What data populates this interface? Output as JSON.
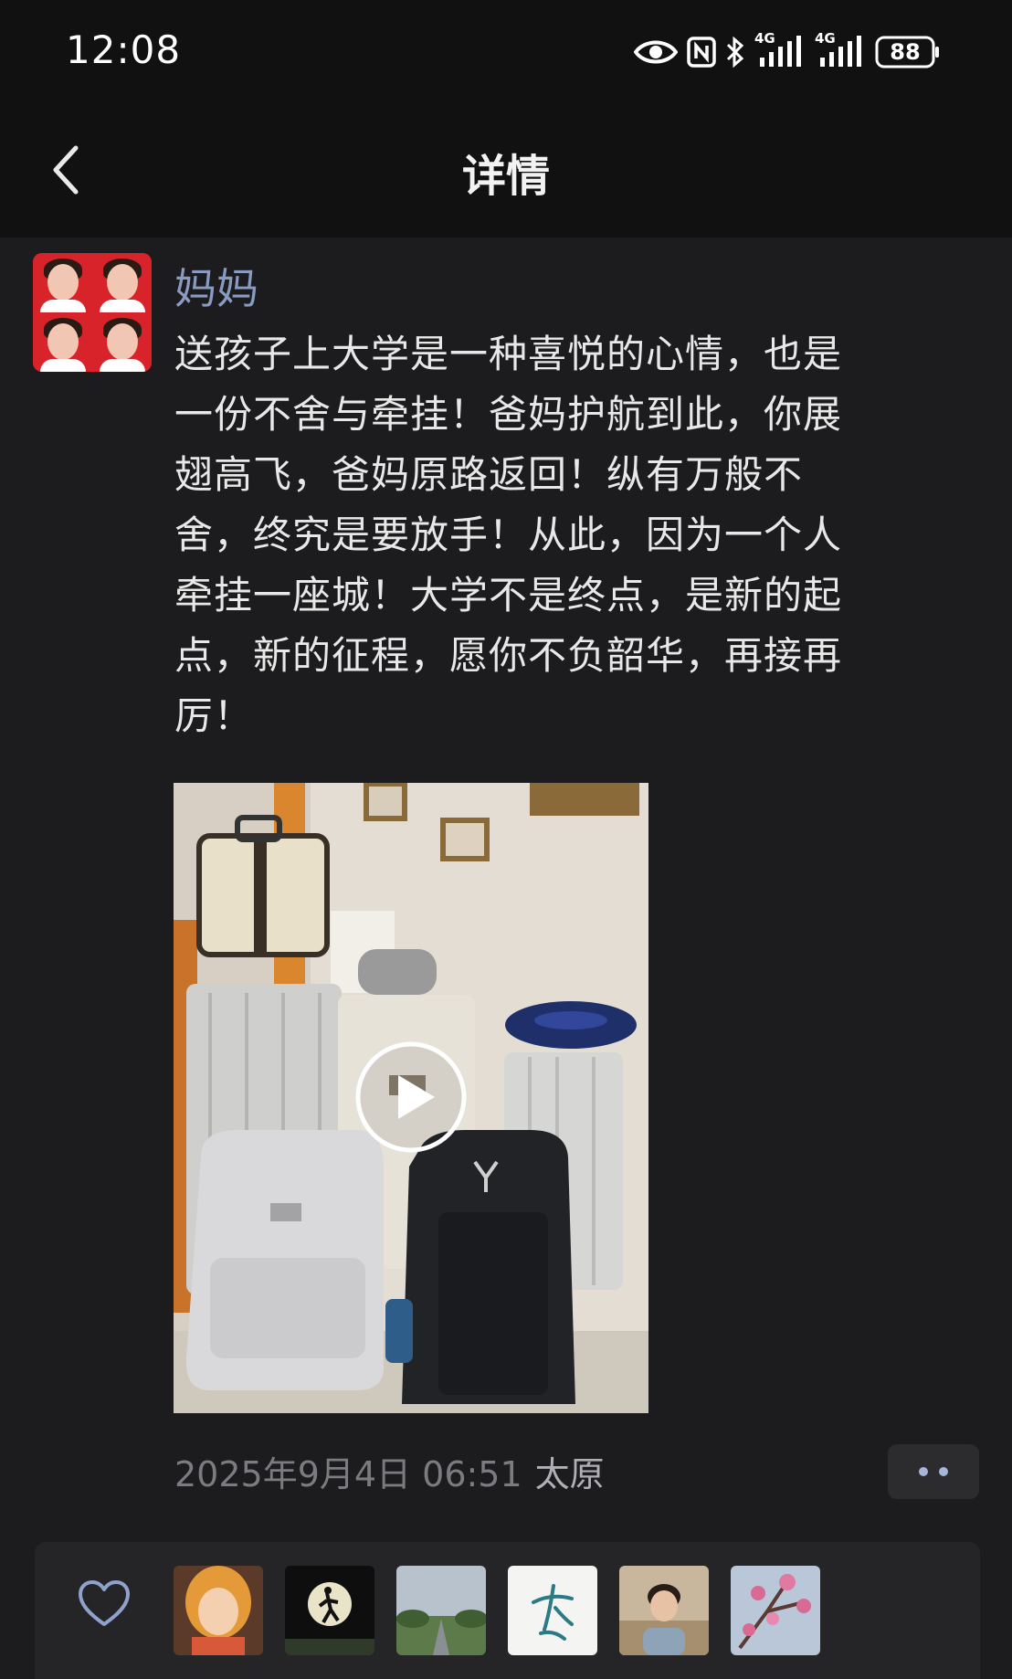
{
  "status_bar": {
    "time": "12:08",
    "network_1": "4G",
    "network_2": "4G",
    "battery": "88",
    "icons": [
      "eye-icon",
      "nfc-icon",
      "bluetooth-icon",
      "signal-icon",
      "signal-icon",
      "battery-icon"
    ]
  },
  "nav": {
    "title": "详情",
    "back_icon": "chevron-left-icon"
  },
  "post": {
    "author": "妈妈",
    "text": "送孩子上大学是一种喜悦的心情，也是\n一份不舍与牵挂！爸妈护航到此，你展\n翅高飞，爸妈原路返回！纵有万般不\n舍，终究是要放手！从此，因为一个人\n牵挂一座城！大学不是终点，是新的起\n点，新的征程，愿你不负韶华，再接再\n厉！",
    "media": {
      "type": "video",
      "play_icon": "play-icon"
    },
    "timestamp": "2025年9月4日 06:51",
    "location": "太原",
    "more_icon": "more-dots-icon"
  },
  "likes": {
    "icon": "heart-icon",
    "likers": [
      {
        "avatar": "cartoon-girl-avatar"
      },
      {
        "avatar": "running-silhouette-avatar"
      },
      {
        "avatar": "road-landscape-avatar"
      },
      {
        "avatar": "calligraphy-avatar"
      },
      {
        "avatar": "person-photo-avatar"
      },
      {
        "avatar": "blossom-avatar"
      }
    ]
  },
  "colors": {
    "background": "#1c1c1e",
    "bar": "#111112",
    "author": "#8a9bc2",
    "text": "#e8e8e8",
    "meta": "#7c7c80",
    "accent": "#a6b6d9"
  }
}
